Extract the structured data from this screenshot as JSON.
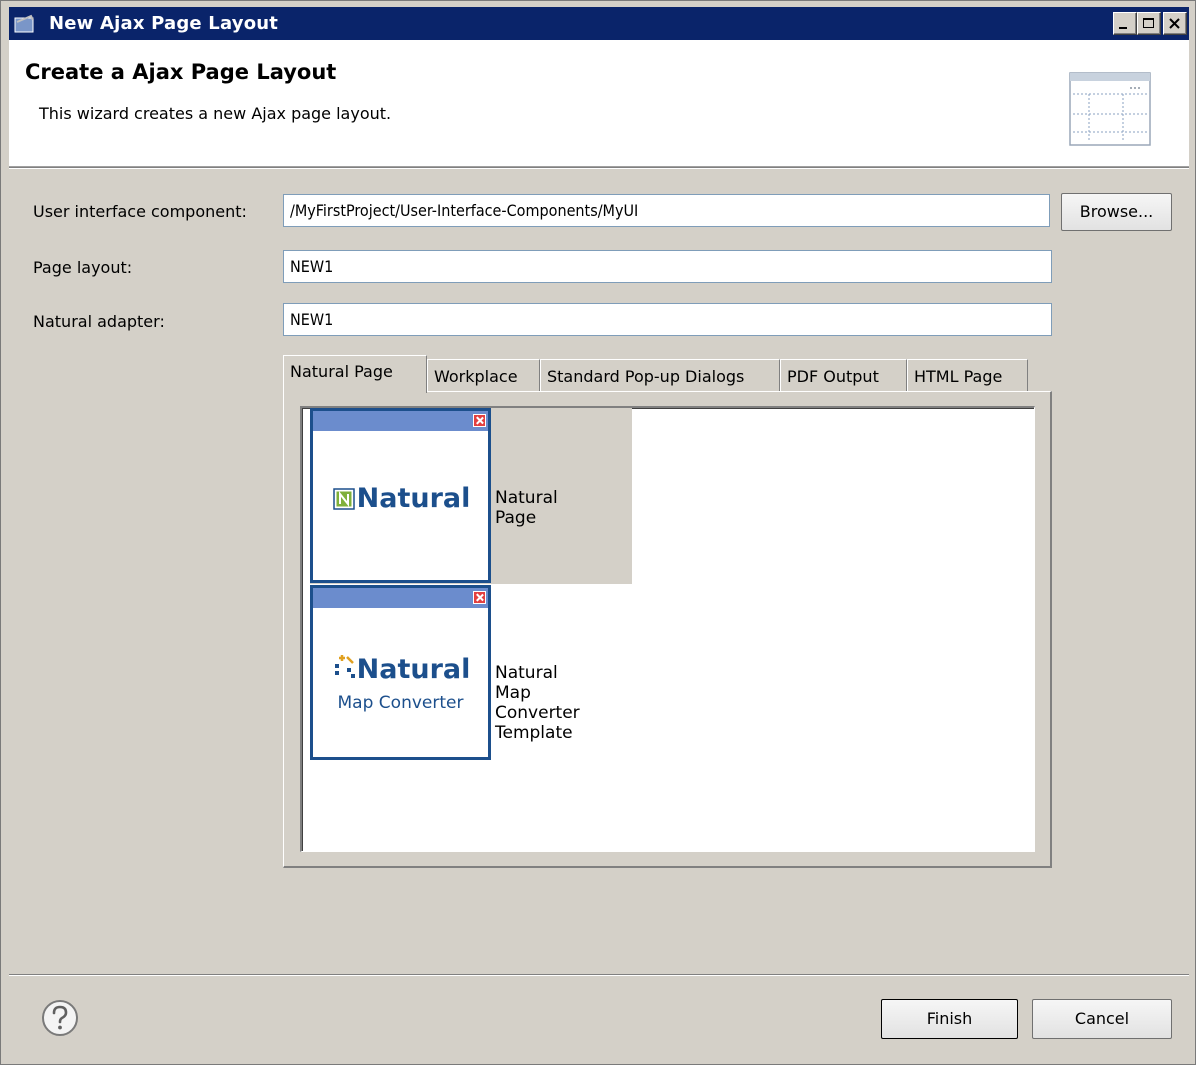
{
  "window": {
    "title": "New Ajax Page Layout"
  },
  "banner": {
    "title": "Create a Ajax Page Layout",
    "description": "This wizard creates a new Ajax page layout."
  },
  "form": {
    "uic_label": "User interface component:",
    "uic_value": "/MyFirstProject/User-Interface-Components/MyUI",
    "browse_label": "Browse...",
    "page_layout_label": "Page layout:",
    "page_layout_value": "NEW1",
    "adapter_label": "Natural adapter:",
    "adapter_value": "NEW1"
  },
  "tabs": [
    {
      "label": "Natural Page",
      "active": true
    },
    {
      "label": "Workplace",
      "active": false
    },
    {
      "label": "Standard Pop-up Dialogs",
      "active": false
    },
    {
      "label": "PDF Output",
      "active": false
    },
    {
      "label": "HTML Page",
      "active": false
    }
  ],
  "templates": [
    {
      "brand": "Natural",
      "sub": "",
      "label": "Natural Page",
      "selected": true,
      "icon": "natural-n-icon"
    },
    {
      "brand": "Natural",
      "sub": "Map Converter",
      "label": "Natural Map Converter Template",
      "selected": false,
      "icon": "map-converter-icon"
    }
  ],
  "footer": {
    "finish_label": "Finish",
    "cancel_label": "Cancel"
  },
  "colors": {
    "titlebar": "#0a246a",
    "brand_blue": "#1c4f8c",
    "thumb_bar": "#6b8ccd",
    "dialog_bg": "#d4d0c8"
  }
}
